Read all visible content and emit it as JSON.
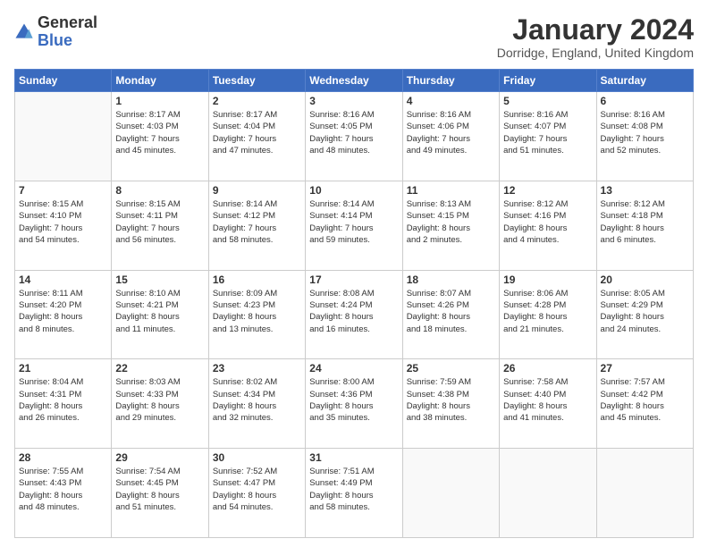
{
  "logo": {
    "general": "General",
    "blue": "Blue"
  },
  "header": {
    "month": "January 2024",
    "location": "Dorridge, England, United Kingdom"
  },
  "days": [
    "Sunday",
    "Monday",
    "Tuesday",
    "Wednesday",
    "Thursday",
    "Friday",
    "Saturday"
  ],
  "weeks": [
    [
      {
        "day": "",
        "info": ""
      },
      {
        "day": "1",
        "info": "Sunrise: 8:17 AM\nSunset: 4:03 PM\nDaylight: 7 hours\nand 45 minutes."
      },
      {
        "day": "2",
        "info": "Sunrise: 8:17 AM\nSunset: 4:04 PM\nDaylight: 7 hours\nand 47 minutes."
      },
      {
        "day": "3",
        "info": "Sunrise: 8:16 AM\nSunset: 4:05 PM\nDaylight: 7 hours\nand 48 minutes."
      },
      {
        "day": "4",
        "info": "Sunrise: 8:16 AM\nSunset: 4:06 PM\nDaylight: 7 hours\nand 49 minutes."
      },
      {
        "day": "5",
        "info": "Sunrise: 8:16 AM\nSunset: 4:07 PM\nDaylight: 7 hours\nand 51 minutes."
      },
      {
        "day": "6",
        "info": "Sunrise: 8:16 AM\nSunset: 4:08 PM\nDaylight: 7 hours\nand 52 minutes."
      }
    ],
    [
      {
        "day": "7",
        "info": "Sunrise: 8:15 AM\nSunset: 4:10 PM\nDaylight: 7 hours\nand 54 minutes."
      },
      {
        "day": "8",
        "info": "Sunrise: 8:15 AM\nSunset: 4:11 PM\nDaylight: 7 hours\nand 56 minutes."
      },
      {
        "day": "9",
        "info": "Sunrise: 8:14 AM\nSunset: 4:12 PM\nDaylight: 7 hours\nand 58 minutes."
      },
      {
        "day": "10",
        "info": "Sunrise: 8:14 AM\nSunset: 4:14 PM\nDaylight: 7 hours\nand 59 minutes."
      },
      {
        "day": "11",
        "info": "Sunrise: 8:13 AM\nSunset: 4:15 PM\nDaylight: 8 hours\nand 2 minutes."
      },
      {
        "day": "12",
        "info": "Sunrise: 8:12 AM\nSunset: 4:16 PM\nDaylight: 8 hours\nand 4 minutes."
      },
      {
        "day": "13",
        "info": "Sunrise: 8:12 AM\nSunset: 4:18 PM\nDaylight: 8 hours\nand 6 minutes."
      }
    ],
    [
      {
        "day": "14",
        "info": "Sunrise: 8:11 AM\nSunset: 4:20 PM\nDaylight: 8 hours\nand 8 minutes."
      },
      {
        "day": "15",
        "info": "Sunrise: 8:10 AM\nSunset: 4:21 PM\nDaylight: 8 hours\nand 11 minutes."
      },
      {
        "day": "16",
        "info": "Sunrise: 8:09 AM\nSunset: 4:23 PM\nDaylight: 8 hours\nand 13 minutes."
      },
      {
        "day": "17",
        "info": "Sunrise: 8:08 AM\nSunset: 4:24 PM\nDaylight: 8 hours\nand 16 minutes."
      },
      {
        "day": "18",
        "info": "Sunrise: 8:07 AM\nSunset: 4:26 PM\nDaylight: 8 hours\nand 18 minutes."
      },
      {
        "day": "19",
        "info": "Sunrise: 8:06 AM\nSunset: 4:28 PM\nDaylight: 8 hours\nand 21 minutes."
      },
      {
        "day": "20",
        "info": "Sunrise: 8:05 AM\nSunset: 4:29 PM\nDaylight: 8 hours\nand 24 minutes."
      }
    ],
    [
      {
        "day": "21",
        "info": "Sunrise: 8:04 AM\nSunset: 4:31 PM\nDaylight: 8 hours\nand 26 minutes."
      },
      {
        "day": "22",
        "info": "Sunrise: 8:03 AM\nSunset: 4:33 PM\nDaylight: 8 hours\nand 29 minutes."
      },
      {
        "day": "23",
        "info": "Sunrise: 8:02 AM\nSunset: 4:34 PM\nDaylight: 8 hours\nand 32 minutes."
      },
      {
        "day": "24",
        "info": "Sunrise: 8:00 AM\nSunset: 4:36 PM\nDaylight: 8 hours\nand 35 minutes."
      },
      {
        "day": "25",
        "info": "Sunrise: 7:59 AM\nSunset: 4:38 PM\nDaylight: 8 hours\nand 38 minutes."
      },
      {
        "day": "26",
        "info": "Sunrise: 7:58 AM\nSunset: 4:40 PM\nDaylight: 8 hours\nand 41 minutes."
      },
      {
        "day": "27",
        "info": "Sunrise: 7:57 AM\nSunset: 4:42 PM\nDaylight: 8 hours\nand 45 minutes."
      }
    ],
    [
      {
        "day": "28",
        "info": "Sunrise: 7:55 AM\nSunset: 4:43 PM\nDaylight: 8 hours\nand 48 minutes."
      },
      {
        "day": "29",
        "info": "Sunrise: 7:54 AM\nSunset: 4:45 PM\nDaylight: 8 hours\nand 51 minutes."
      },
      {
        "day": "30",
        "info": "Sunrise: 7:52 AM\nSunset: 4:47 PM\nDaylight: 8 hours\nand 54 minutes."
      },
      {
        "day": "31",
        "info": "Sunrise: 7:51 AM\nSunset: 4:49 PM\nDaylight: 8 hours\nand 58 minutes."
      },
      {
        "day": "",
        "info": ""
      },
      {
        "day": "",
        "info": ""
      },
      {
        "day": "",
        "info": ""
      }
    ]
  ]
}
